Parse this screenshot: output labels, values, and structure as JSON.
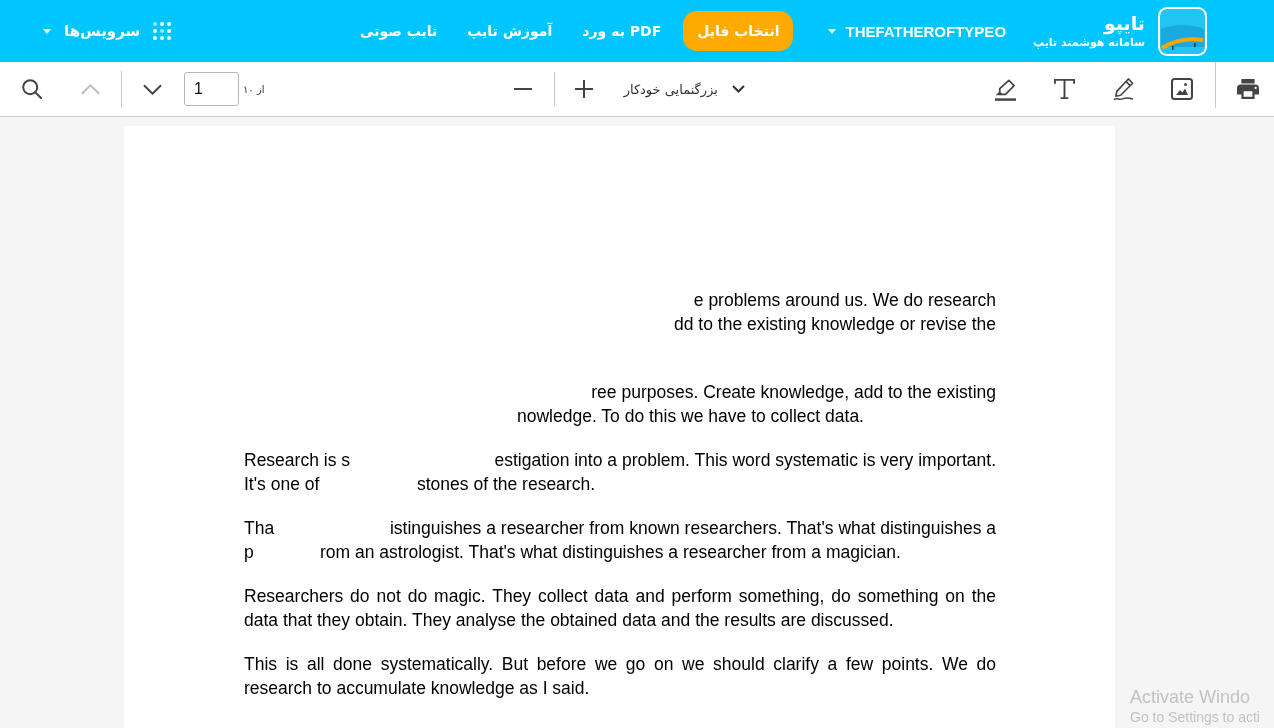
{
  "header": {
    "brand": {
      "title": "تایپو",
      "tagline": "سامانه هوشمند تایپ"
    },
    "user_menu": {
      "label": "THEFATHEROFTYPEO"
    },
    "primary_button": {
      "label": "انتخاب فایل"
    },
    "nav_links": [
      {
        "label": "PDF به ورد"
      },
      {
        "label": "آموزش تایپ"
      },
      {
        "label": "تایپ صوتی"
      }
    ],
    "services_menu": {
      "label": "سرویس‌ها"
    }
  },
  "toolbar": {
    "previous_page": {
      "disabled": true
    },
    "next_page": {
      "disabled": false
    },
    "page_field": {
      "value": "1"
    },
    "page_count": "از ۱۰",
    "zoom": {
      "label": "بزرگنمایی خودکار"
    }
  },
  "document": {
    "paragraphs": [
      {
        "kind": "fragmented",
        "lines": [
          {
            "after_gap": "e problems around us. We do research"
          },
          {
            "after_gap": "dd to the existing knowledge or revise the"
          }
        ]
      },
      {
        "kind": "fragmented",
        "lines": [
          {
            "after_gap": "ree purposes. Create knowledge, add to the existing"
          },
          {
            "after_gap": "nowledge. To do this we have to collect data."
          }
        ]
      },
      {
        "kind": "fragmented",
        "lines": [
          {
            "before_gap": "Research is s",
            "after_gap": "estigation into a problem. This word systematic is very important."
          },
          {
            "before_gap": "It's one of",
            "after_gap": "stones of the research."
          }
        ]
      },
      {
        "kind": "fragmented",
        "lines": [
          {
            "before_gap": "Tha",
            "after_gap": "istinguishes a researcher from known researchers. That's what distinguishes a"
          },
          {
            "before_gap": "p",
            "after_gap": "rom an astrologist. That's what distinguishes a researcher from a magician."
          }
        ]
      },
      {
        "kind": "text",
        "lines": [
          "Researchers do not do magic. They collect data and perform something, do something on the",
          "data that they obtain. They analyse the obtained data and the results are discussed."
        ]
      },
      {
        "kind": "text",
        "lines": [
          "This is all done systematically. But before we go on we should clarify a few points. We do",
          "research to accumulate knowledge as I said."
        ]
      }
    ]
  },
  "system_notice": {
    "title": "Activate Windo",
    "subtitle": "Go to Settings to acti"
  }
}
